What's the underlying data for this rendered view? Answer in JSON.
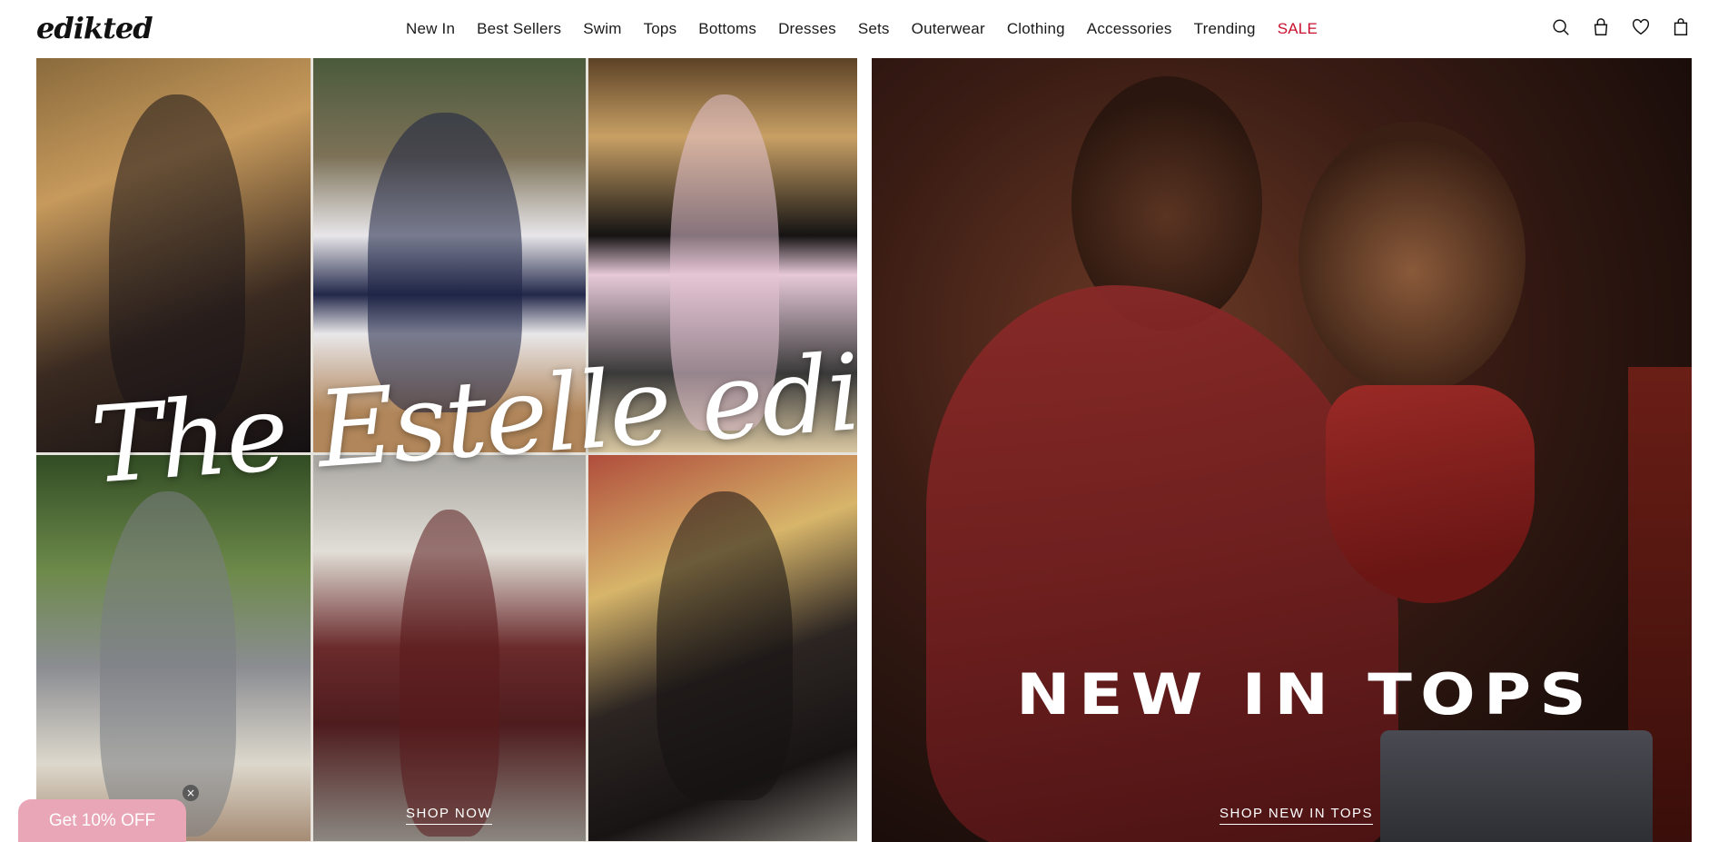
{
  "header": {
    "logo_text": "edikted",
    "nav": [
      {
        "label": "New In"
      },
      {
        "label": "Best Sellers"
      },
      {
        "label": "Swim"
      },
      {
        "label": "Tops"
      },
      {
        "label": "Bottoms"
      },
      {
        "label": "Dresses"
      },
      {
        "label": "Sets"
      },
      {
        "label": "Outerwear"
      },
      {
        "label": "Clothing"
      },
      {
        "label": "Accessories"
      },
      {
        "label": "Trending"
      },
      {
        "label": "SALE"
      }
    ],
    "icons": [
      "search-icon",
      "account-icon",
      "wishlist-icon",
      "cart-icon"
    ],
    "sale_color": "#c8102e"
  },
  "hero_left": {
    "script_title": "The Estelle edit",
    "cta": "SHOP NOW"
  },
  "hero_right": {
    "title": "NEW IN TOPS",
    "cta": "SHOP NEW IN TOPS"
  },
  "promo": {
    "label": "Get 10% OFF",
    "close_symbol": "×",
    "color": "#e8a6b6"
  }
}
